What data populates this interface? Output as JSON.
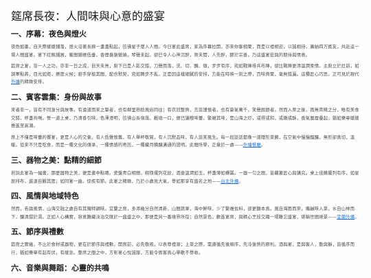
{
  "title": "筵席長夜：人間味與心意的盛宴",
  "sections": [
    {
      "heading": "一、序幕：夜色與燈火",
      "paras": [
        {
          "pre": "夜色如墨，自天際緩緩鋪落，燈火沿著長廊一盞盞點起，彷彿星子墜入人間。今日宴此盛席，家為序幕拉開，亦來你客相聚，而是以禮相迎，以誠相待，廣納四方賓友，共赴這一場人間盛宴。宴下紅氈鋪展，暖間鋪帳低垂，香煙裊裊縈繞，琴聲未起，卻已令人心神沉醉，席未開，人先醉，酵於宗善，乃這盛宴宏與的期待與情意。"
        },
        {
          "pre": "筵席之宴，非一人之功，亦非一日之成，自天未亮，廚下已是人影交錯，刀聲雨落，洗、切、醃、燉，步步有序，宛如戰陣排兵布陣，卻比戰陣更添溫潤柔情。主廚立於灶前，如調軍點將，目光如炬，擦度火候；廚手穿梭其間，配合默契，宛如舞步不亂。正是因這樣細膩的安排，方能在時映一刻之際，百味齊聚，毫無錯漏。這種匠心巧思，正可見於現代",
          "link": "外燴",
          "post": "的精緻安排。"
        }
      ]
    },
    {
      "heading": "二、賓客雲集：身份與故事",
      "paras": [
        {
          "pre": "來者非一，皆有不同身分與故事。有遠道而來之摯者，也有鄰里熟稔風俗同往；有衣冠整齊，言談謹慎者，也有豪氣萬千，笑聲朗朗者。然而入席之後，再無貴賤之分，唯有美食交錯，杯盞共鳴。誓一道上桌，乃清香引味，色澤澄明，彷彿山長嶺靄，觀瑙一口，便已議贈味蕾，繁雜其味，是山海之珍，或得或和，或嫩或酥，香氣層層疊起，猶如樂章緩緩推進至高潮。"
        },
        {
          "pre": "席上不僅是味蕾的饗宴，更是人心的交會。有人低聲敘舊，有人舉杯敬賀，有人沉默品味，有人談笑風生。每一段談話都像一道隱形菜餚，在空氣中慢慢醞釀，無形卻真切，溫暖。從來不只是吃食，而是一種文化的傳承，一種情感的寄託，一種藏月積釀溝通的證明。此間所學，正彙於一處——",
          "link": "外燴餐廳",
          "post": "。"
        }
      ]
    },
    {
      "heading": "三、器物之美：點精的細節",
      "paras": [
        {
          "pre": "若說此宴為一幅畫，那麼器物之美，便是畫中點睛。瓷盤青白相間，碗筷擺列花紋，酒壺溫潤如玉，杯盞薄如蟬翼。一器一匀之間，皆藏著匠心與講究。桌上佳餚擺列有序，如星辰排布，進退自觀其度；如同宴一曲，徐疾有節。此宴之精緻，乃於小處見大氣，譽如那享有盛名之地——",
          "link": "台北外燴",
          "post": "。"
        }
      ]
    },
    {
      "heading": "四、風情與地域特色",
      "paras": [
        {
          "pre": "然而，若論風情，山海交融之處自有其獨特韻味。宜蘭之席，多添幾分自然清新，山間蔬果，海中鮮味，少了繁複佐料，卻更顯本真。風自海面而來，攜鹹味入菜，水自山林而下，釀清甜於湯。正如人心構實，容意難藏淡泊交匯於一盛盛之中，那便是另一番境界所在；自然景色，歡進宴席，與精心烹技交織一場難忘盛宴，堪稱世間絕景——",
          "link": "宜蘭外燴",
          "post": "。"
        }
      ]
    },
    {
      "heading": "五、節序與禮數",
      "paras": [
        {
          "pre": "筵席之實幾，不止於食材或器物，更在於節序與禮數。開席前，必先敬祖，以表尊禮源；上菜之際，需遵循先後順序，先冷後熱的原則。酒與宴，是與客人，動與靜，皆循序而行，猶如樂章有起有伏，有緩急。整席之間之中，方彰宴心悅誠服，方能令賓客真心舉歡不譽收。"
        }
      ]
    },
    {
      "heading": "六、音樂與舞蹈：心靈的共鳴",
      "paras": []
    }
  ]
}
